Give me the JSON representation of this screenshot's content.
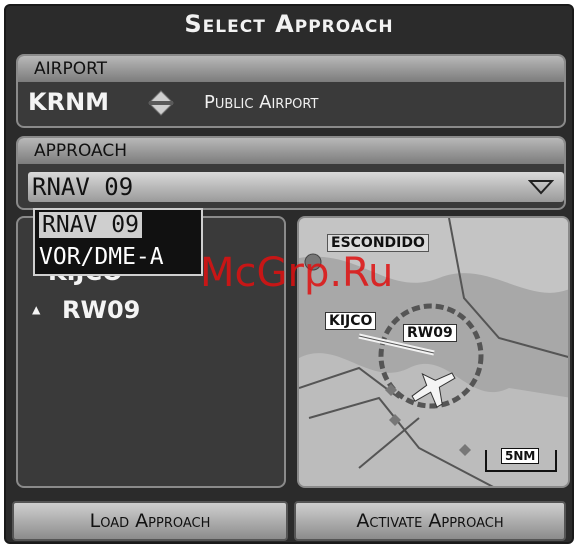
{
  "window": {
    "title": "Select Approach"
  },
  "airport": {
    "header": "AIRPORT",
    "ident": "KRNM",
    "type": "Public Airport",
    "icon": "airport-diamond-icon"
  },
  "approach": {
    "header": "APPROACH",
    "selected": "RNAV 09",
    "options": [
      "RNAV 09",
      "VOR/DME-A"
    ]
  },
  "transitions": {
    "items": [
      {
        "label": "KIJCO",
        "marker": ""
      },
      {
        "label": "RW09",
        "marker": "▲"
      }
    ]
  },
  "map": {
    "labels": {
      "city": "ESCONDIDO",
      "waypoint": "KIJCO",
      "runway": "RW09"
    },
    "scale": "5NM"
  },
  "buttons": {
    "load": "Load Approach",
    "activate": "Activate Approach"
  },
  "watermark": "McGrp.Ru",
  "colors": {
    "panel": "#2b2b2b",
    "header": "#a0a0a0",
    "text": "#f4f4f4"
  }
}
